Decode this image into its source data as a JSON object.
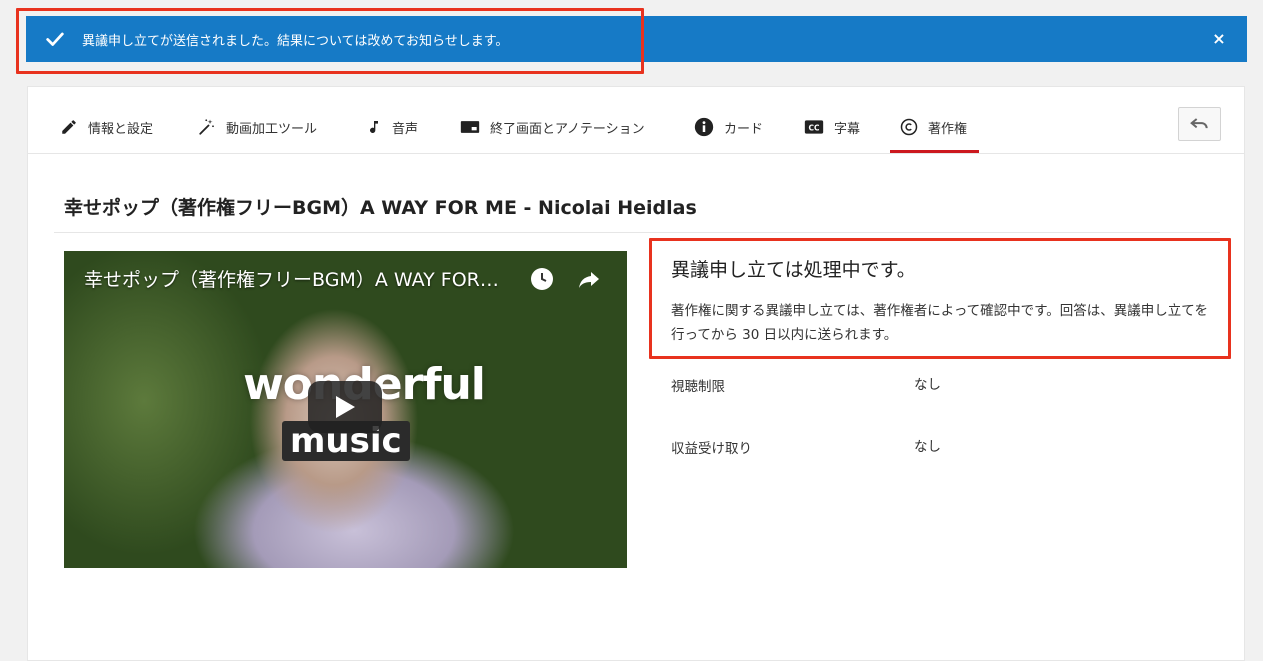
{
  "notification": {
    "message": "異議申し立てが送信されました。結果については改めてお知らせします。",
    "close_label": "×",
    "color": "#167ac6"
  },
  "tabs": [
    {
      "label": "情報と設定",
      "icon": "pencil-icon"
    },
    {
      "label": "動画加工ツール",
      "icon": "magic-wand-icon"
    },
    {
      "label": "音声",
      "icon": "music-note-icon"
    },
    {
      "label": "終了画面とアノテーション",
      "icon": "end-screen-icon"
    },
    {
      "label": "カード",
      "icon": "info-icon"
    },
    {
      "label": "字幕",
      "icon": "cc-icon"
    },
    {
      "label": "著作権",
      "icon": "copyright-icon",
      "active": true
    }
  ],
  "video": {
    "title": "幸せポップ（著作権フリーBGM）A WAY FOR ME - Nicolai Heidlas",
    "player_title": "幸せポップ（著作権フリーBGM）A WAY FOR ME - Nicolai Heidlas",
    "overlay_text_1": "wonderful",
    "overlay_text_2": "music"
  },
  "status": {
    "title": "異議申し立ては処理中です。",
    "description": "著作権に関する異議申し立ては、著作権者によって確認中です。回答は、異議申し立てを行ってから 30 日以内に送られます。"
  },
  "details": [
    {
      "label": "視聴制限",
      "value": "なし"
    },
    {
      "label": "収益受け取り",
      "value": "なし"
    }
  ],
  "colors": {
    "accent_red": "#cc181e",
    "highlight": "#e8321e"
  }
}
